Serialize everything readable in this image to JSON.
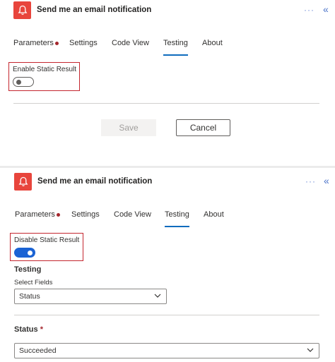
{
  "panel_top": {
    "header": {
      "title": "Send me an email notification",
      "more": "···",
      "collapse": "«"
    },
    "tabs": [
      {
        "label": "Parameters",
        "has_dot": true
      },
      {
        "label": "Settings"
      },
      {
        "label": "Code View"
      },
      {
        "label": "Testing",
        "active": true
      },
      {
        "label": "About"
      }
    ],
    "toggle": {
      "label": "Enable Static Result",
      "state": "off"
    },
    "buttons": {
      "save": "Save",
      "cancel": "Cancel"
    }
  },
  "panel_bottom": {
    "header": {
      "title": "Send me an email notification",
      "more": "···",
      "collapse": "«"
    },
    "tabs": [
      {
        "label": "Parameters",
        "has_dot": true
      },
      {
        "label": "Settings"
      },
      {
        "label": "Code View"
      },
      {
        "label": "Testing",
        "active": true
      },
      {
        "label": "About"
      }
    ],
    "toggle": {
      "label": "Disable Static Result",
      "state": "on"
    },
    "testing": {
      "heading": "Testing",
      "select_fields_label": "Select Fields",
      "select_fields_value": "Status"
    },
    "status": {
      "label": "Status",
      "required_mark": "*",
      "value": "Succeeded"
    }
  },
  "colors": {
    "accent": "#0f6cbd",
    "icon_bg": "#e8453c",
    "highlight_box": "#c4262e",
    "toggle_on": "#1b63d4"
  }
}
